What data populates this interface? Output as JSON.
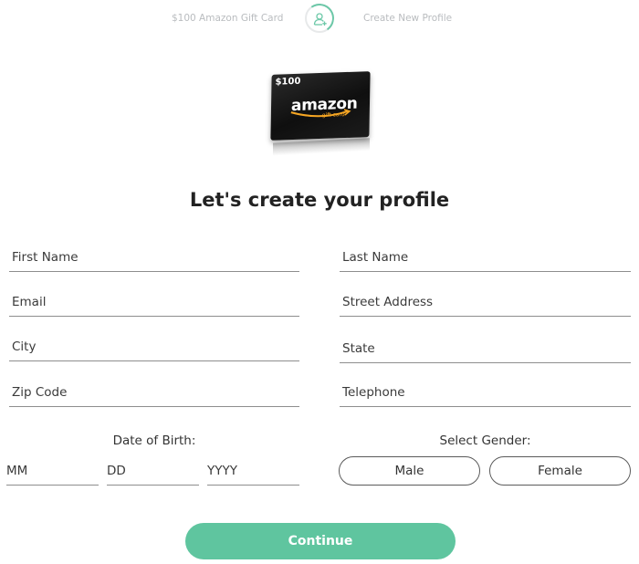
{
  "progress": {
    "left_label": "$100 Amazon Gift Card",
    "right_label": "Create New Profile",
    "icon": "add-user-icon",
    "accent_color": "#6cc8a8"
  },
  "gift_card": {
    "amount": "$100",
    "brand": "amazon",
    "subtitle": "gift card"
  },
  "headline": "Let's create your profile",
  "form": {
    "first_name": {
      "placeholder": "First Name",
      "value": ""
    },
    "last_name": {
      "placeholder": "Last Name",
      "value": ""
    },
    "email": {
      "placeholder": "Email",
      "value": ""
    },
    "street_address": {
      "placeholder": "Street Address",
      "value": ""
    },
    "city": {
      "placeholder": "City",
      "value": ""
    },
    "state": {
      "placeholder": "State",
      "value": ""
    },
    "zip_code": {
      "placeholder": "Zip Code",
      "value": ""
    },
    "telephone": {
      "placeholder": "Telephone",
      "value": ""
    }
  },
  "dob": {
    "label": "Date of Birth:",
    "month_placeholder": "MM",
    "day_placeholder": "DD",
    "year_placeholder": "YYYY"
  },
  "gender": {
    "label": "Select Gender:",
    "options": [
      "Male",
      "Female"
    ]
  },
  "continue_label": "Continue",
  "colors": {
    "primary": "#5fc59f",
    "muted_text": "#b9bcbf"
  }
}
